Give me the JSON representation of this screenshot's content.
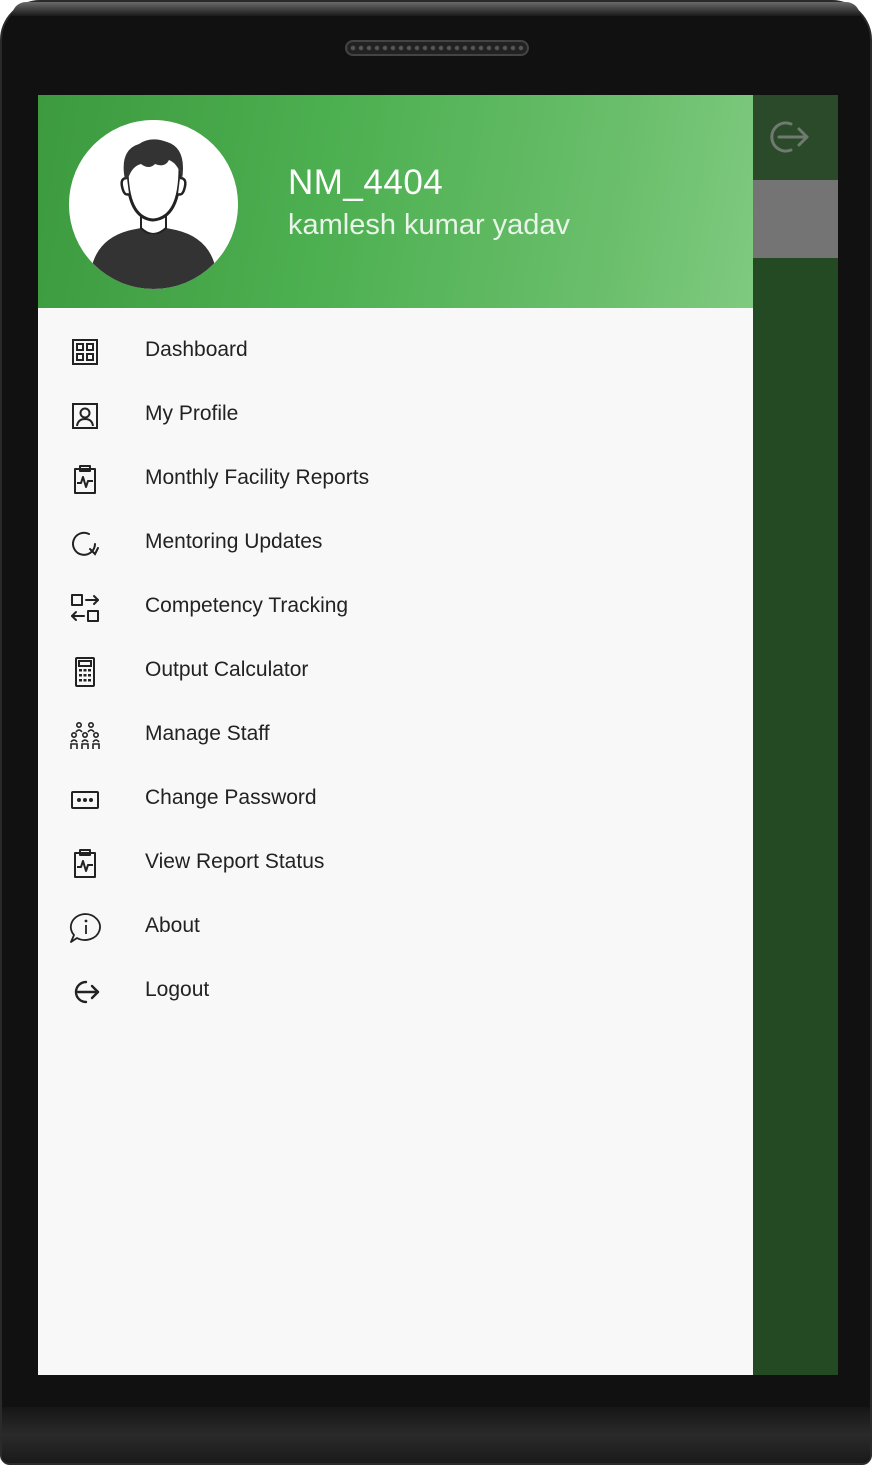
{
  "user": {
    "id": "NM_4404",
    "name": "kamlesh kumar yadav"
  },
  "menu": {
    "items": [
      {
        "label": "Dashboard",
        "icon": "dashboard-icon"
      },
      {
        "label": "My Profile",
        "icon": "profile-icon"
      },
      {
        "label": "Monthly Facility Reports",
        "icon": "clipboard-pulse-icon"
      },
      {
        "label": "Mentoring Updates",
        "icon": "refresh-icon"
      },
      {
        "label": "Competency Tracking",
        "icon": "swap-icon"
      },
      {
        "label": "Output Calculator",
        "icon": "calculator-icon"
      },
      {
        "label": "Manage Staff",
        "icon": "staff-group-icon"
      },
      {
        "label": "Change Password",
        "icon": "password-icon"
      },
      {
        "label": "View Report Status",
        "icon": "clipboard-pulse-icon"
      },
      {
        "label": "About",
        "icon": "info-bubble-icon"
      },
      {
        "label": "Logout",
        "icon": "logout-icon"
      }
    ]
  },
  "colors": {
    "header_green": "#4caf50",
    "scrim_green": "#234a23",
    "drawer_bg": "#f8f8f8"
  }
}
